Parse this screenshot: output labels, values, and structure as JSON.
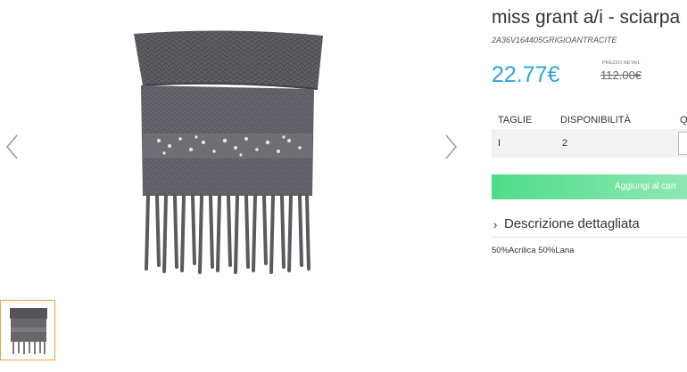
{
  "product": {
    "title": "miss grant a/i - sciarpa",
    "sku": "2A36V164405GRIGIOANTRACITE",
    "price": "22.77€",
    "retail_label": "PREZZO RETAIL",
    "retail_price": "112.00€"
  },
  "table": {
    "headers": [
      "TAGLIE",
      "DISPONIBILITÀ",
      "Q"
    ],
    "rows": [
      {
        "size": "I",
        "availability": "2",
        "quantity": ""
      }
    ]
  },
  "cart_button": {
    "label": "Aggiungi al carr"
  },
  "description": {
    "heading": "Descrizione dettagliata",
    "composition": "50%Acrilica 50%Lana"
  },
  "icons": {
    "prev": "chevron-left-icon",
    "next": "chevron-right-icon",
    "expand": "chevron-right-icon"
  },
  "colors": {
    "price": "#2aa7d8",
    "cart_start": "#4fdc8a",
    "cart_end": "#8ee8b3",
    "thumb_border": "#f0a23c",
    "scarf": "#5f5f63"
  }
}
